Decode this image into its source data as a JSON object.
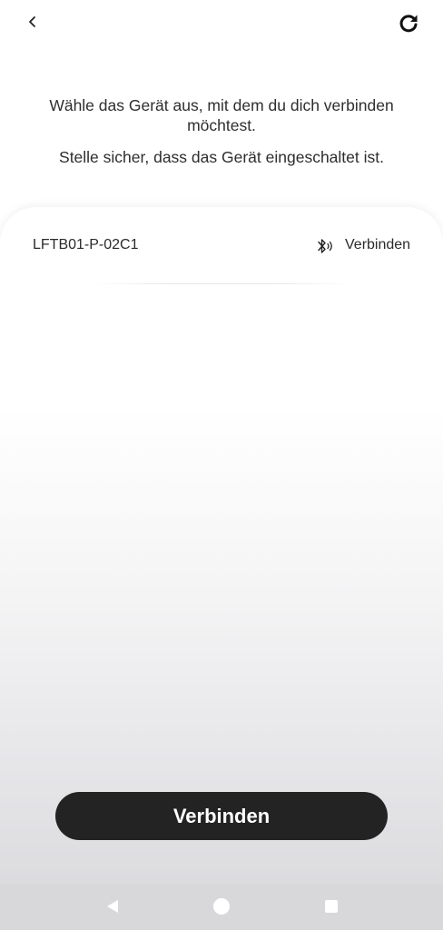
{
  "header": {
    "back_icon": "chevron-left-icon",
    "refresh_icon": "refresh-icon"
  },
  "instructions": {
    "line1": "Wähle das Gerät aus, mit dem du dich verbinden möchtest.",
    "line2": "Stelle sicher, dass das Gerät eingeschaltet ist."
  },
  "devices": [
    {
      "name": "LFTB01-P-02C1",
      "icon": "bluetooth-icon",
      "action_label": "Verbinden"
    }
  ],
  "primary_button": {
    "label": "Verbinden",
    "background": "#232323",
    "text_color": "#ffffff"
  },
  "navigation_bar": {
    "buttons": [
      "back-triangle-icon",
      "home-circle-icon",
      "recents-square-icon"
    ]
  }
}
